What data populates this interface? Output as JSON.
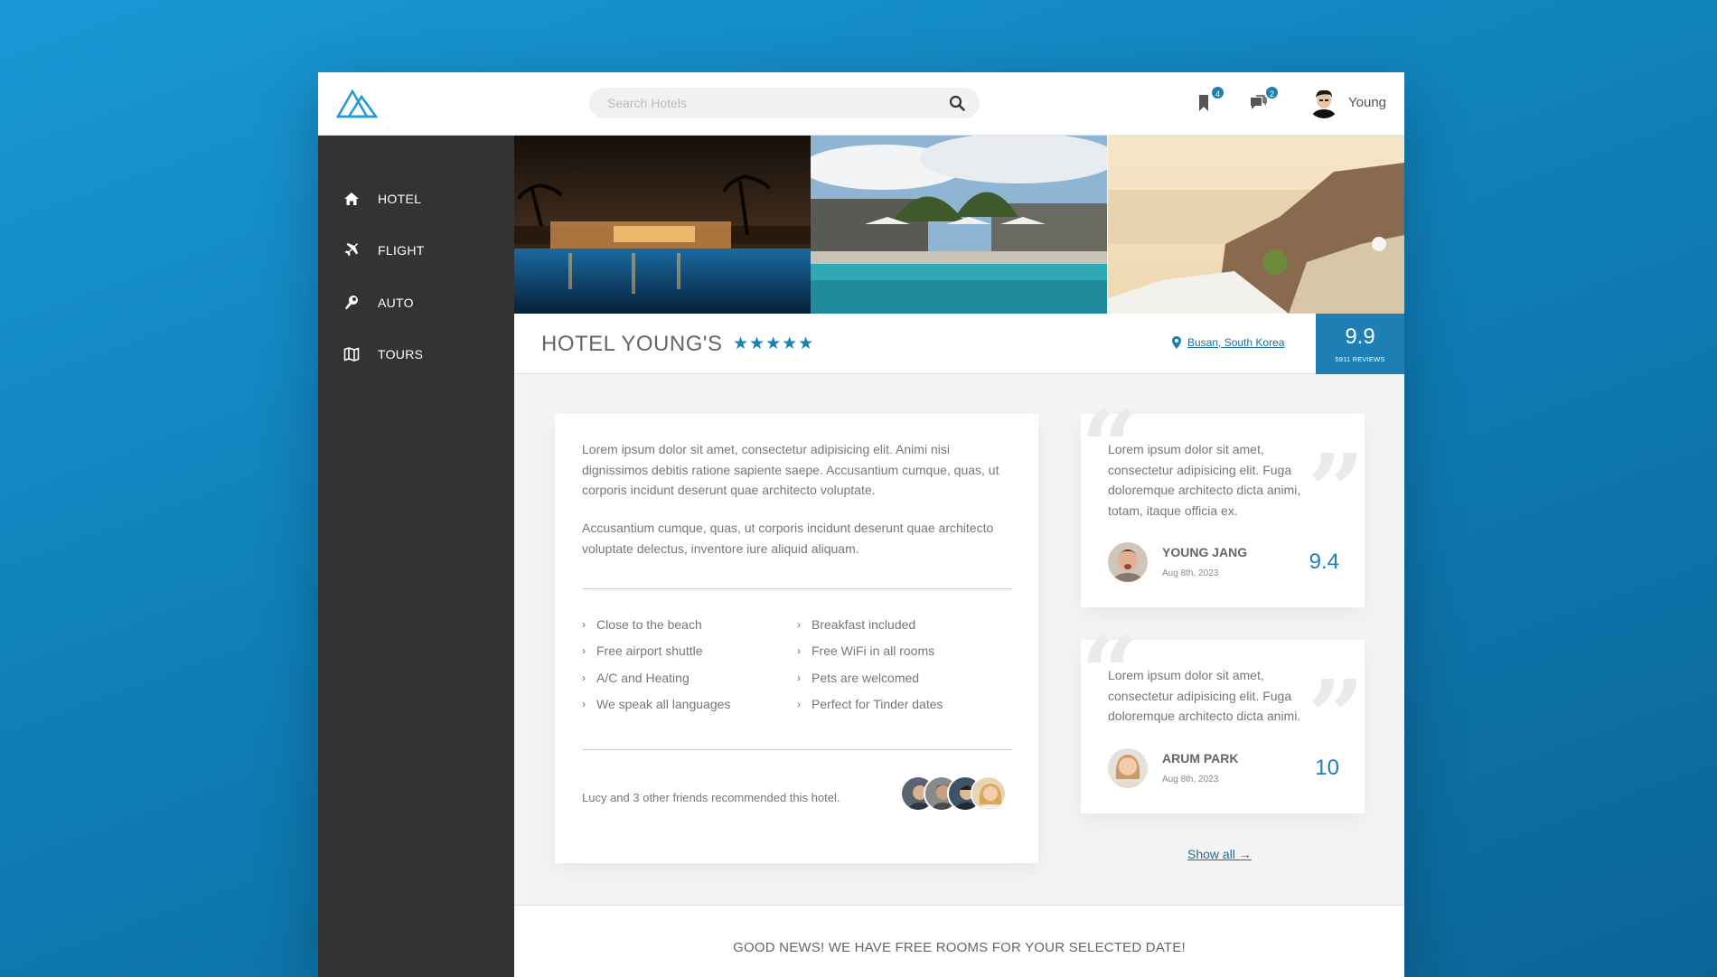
{
  "header": {
    "search_placeholder": "Search Hotels",
    "bookmark_badge": "4",
    "messages_badge": "2",
    "user_name": "Young"
  },
  "sidebar": {
    "items": [
      {
        "label": "HOTEL",
        "icon": "home-icon"
      },
      {
        "label": "FLIGHT",
        "icon": "plane-icon"
      },
      {
        "label": "AUTO",
        "icon": "wrench-icon"
      },
      {
        "label": "TOURS",
        "icon": "map-icon"
      }
    ]
  },
  "hotel": {
    "name": "HOTEL YOUNG'S",
    "stars": "★★★★★",
    "rating_stars": 5,
    "location": "Busan, South Korea",
    "score": "9.9",
    "reviews": "5911 REVIEWS"
  },
  "description": {
    "paragraph1": "Lorem ipsum dolor sit amet, consectetur adipisicing elit. Animi nisi dignissimos debitis ratione sapiente saepe. Accusantium cumque, quas, ut corporis incidunt deserunt quae architecto voluptate.",
    "paragraph2": "Accusantium cumque, quas, ut corporis incidunt deserunt quae architecto voluptate delectus, inventore iure aliquid aliquam.",
    "features": [
      "Close to the beach",
      "Free airport shuttle",
      "A/C and Heating",
      "We speak all languages",
      "Breakfast included",
      "Free WiFi in all rooms",
      "Pets are welcomed",
      "Perfect for Tinder dates"
    ],
    "friends_text": "Lucy and 3 other friends recommended this hotel."
  },
  "reviews": [
    {
      "text": "Lorem ipsum dolor sit amet, consectetur adipisicing elit. Fuga doloremque architecto dicta animi, totam, itaque officia ex.",
      "name": "YOUNG JANG",
      "date": "Aug 8th, 2023",
      "score": "9.4"
    },
    {
      "text": "Lorem ipsum dolor sit amet, consectetur adipisicing elit. Fuga doloremque architecto dicta animi.",
      "name": "ARUM PARK",
      "date": "Aug 8th, 2023",
      "score": "10"
    }
  ],
  "show_all": "Show all →",
  "footer_text": "GOOD NEWS! WE HAVE FREE ROOMS FOR YOUR SELECTED DATE!",
  "colors": {
    "accent": "#1d7fb4",
    "sidebar": "#333333",
    "background": "#1a98d5"
  }
}
